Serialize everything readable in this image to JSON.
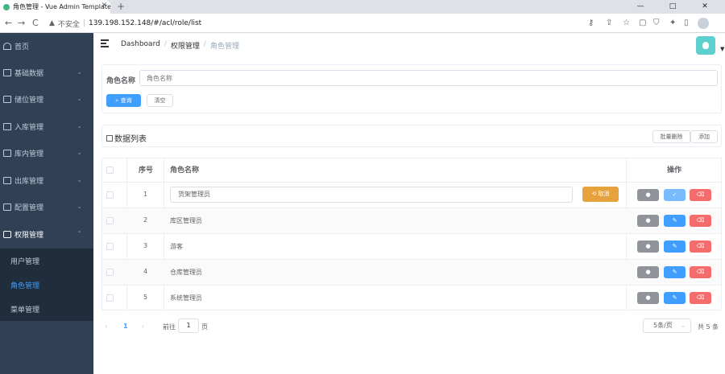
{
  "browser": {
    "tab_title": "角色管理 - Vue Admin Template",
    "new_tab": "+",
    "back": "←",
    "forward": "→",
    "reload": "C",
    "insecure_label": "不安全",
    "separator": "|",
    "url": "139.198.152.148/#/acl/role/list",
    "win_min": "—",
    "win_max": "□",
    "win_close": "✕"
  },
  "sidebar": {
    "items": [
      {
        "label": "首页"
      },
      {
        "label": "基础数据"
      },
      {
        "label": "储位管理"
      },
      {
        "label": "入库管理"
      },
      {
        "label": "库内管理"
      },
      {
        "label": "出库管理"
      },
      {
        "label": "配置管理"
      },
      {
        "label": "权限管理"
      }
    ],
    "submenu": [
      {
        "label": "用户管理"
      },
      {
        "label": "角色管理"
      },
      {
        "label": "菜单管理"
      }
    ],
    "active_color": "#409eff",
    "bg_color": "#304156"
  },
  "breadcrumb": [
    "Dashboard",
    "权限管理",
    "角色管理"
  ],
  "breadcrumb_sep": "/",
  "search": {
    "label": "角色名称",
    "placeholder": "角色名称",
    "search_btn": "查询",
    "clear_btn": "清空"
  },
  "list": {
    "title": "数据列表",
    "batch_delete": "批量删除",
    "add": "添加"
  },
  "table": {
    "headers": [
      "序号",
      "角色名称",
      "操作"
    ],
    "rows": [
      {
        "index": "1",
        "name": "货架管理员",
        "editing": true
      },
      {
        "index": "2",
        "name": "库区管理员"
      },
      {
        "index": "3",
        "name": "游客"
      },
      {
        "index": "4",
        "name": "仓库管理员"
      },
      {
        "index": "5",
        "name": "系统管理员"
      }
    ],
    "cancel_btn": "取消"
  },
  "pagination": {
    "current_page": "1",
    "goto_prefix": "前往",
    "goto_value": "1",
    "goto_suffix": "页",
    "page_size": "5条/页",
    "total": "共 5 条"
  }
}
